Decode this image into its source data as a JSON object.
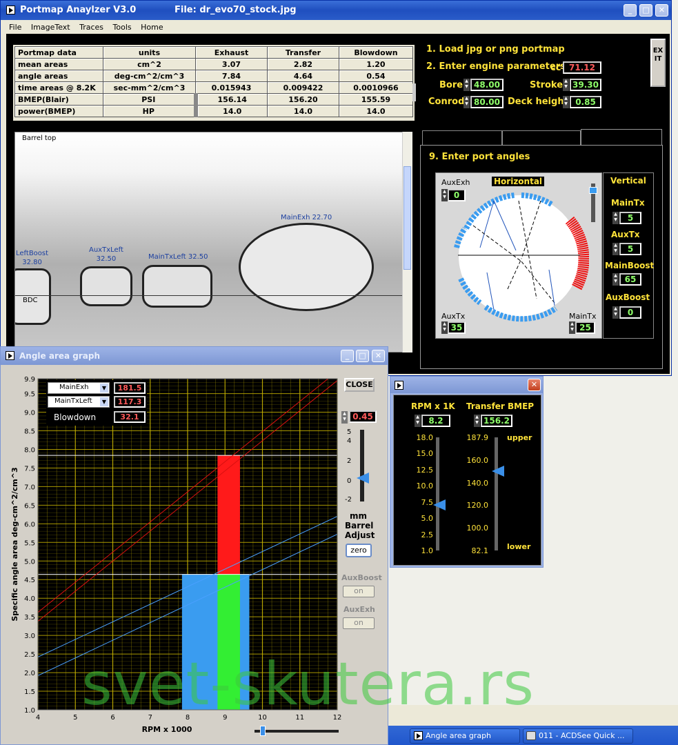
{
  "main_window": {
    "title": "Portmap Anaylzer V3.0",
    "file_label": "File:  dr_evo70_stock.jpg",
    "menu": [
      "File",
      "ImageText",
      "Traces",
      "Tools",
      "Home"
    ],
    "table": {
      "headers": [
        "Portmap data",
        "units",
        "Exhaust",
        "Transfer",
        "Blowdown"
      ],
      "rows": [
        [
          "mean areas",
          "cm^2",
          "3.07",
          "2.82",
          "1.20"
        ],
        [
          "angle areas",
          "deg-cm^2/cm^3",
          "7.84",
          "4.64",
          "0.54"
        ],
        [
          "time areas @ 8.2K",
          "sec-mm^2/cm^3",
          "0.015943",
          "0.009422",
          "0.0010966"
        ],
        [
          "BMEP(Blair)",
          "PSI",
          "156.14",
          "156.20",
          "155.59"
        ],
        [
          "power(BMEP)",
          "HP",
          "14.0",
          "14.0",
          "14.0"
        ]
      ]
    },
    "steps": {
      "load": "1. Load jpg or png portmap",
      "enter_params": "2. Enter engine parameters",
      "port_angles": "9. Enter port angles"
    },
    "exit_label": "EXIT",
    "params": {
      "cc_label": "cc",
      "cc": "71.12",
      "bore_label": "Bore",
      "bore": "48.00",
      "stroke_label": "Stroke",
      "stroke": "39.30",
      "conrod_label": "Conrod",
      "conrod": "80.00",
      "deck_label": "Deck height",
      "deck": "0.85"
    },
    "image": {
      "barrel_top": "Barrel top",
      "bdc": "BDC",
      "ports": [
        {
          "name": "LeftBoost",
          "value": "32.80"
        },
        {
          "name": "AuxTxLeft",
          "value": "32.50"
        },
        {
          "name": "MainTxLeft",
          "value": "32.50"
        },
        {
          "name": "MainExh",
          "value": "22.70"
        }
      ]
    },
    "angles": {
      "horizontal_label": "Horizontal",
      "vertical_label": "Vertical",
      "auxexh_label": "AuxExh",
      "auxexh": "0",
      "auxtx_corner_label": "AuxTx",
      "auxtx_corner": "35",
      "maintx_corner_label": "MainTx",
      "maintx_corner": "25",
      "vertical_items": [
        {
          "label": "MainTx",
          "value": "5"
        },
        {
          "label": "AuxTx",
          "value": "5"
        },
        {
          "label": "MainBoost",
          "value": "65"
        },
        {
          "label": "AuxBoost",
          "value": "0"
        }
      ]
    }
  },
  "graph_window": {
    "title": "Angle area graph",
    "close_label": "CLOSE",
    "legend": [
      {
        "name": "MainExh",
        "value": "181.5"
      },
      {
        "name": "MainTxLeft",
        "value": "117.3"
      },
      {
        "name": "Blowdown",
        "value": "32.1"
      }
    ],
    "barrel_value": "0.45",
    "slider_ticks": [
      "5",
      "4",
      "2",
      "0",
      "-2"
    ],
    "mm_label": "mm",
    "barrel_label": "Barrel",
    "adjust_label": "Adjust",
    "zero_label": "zero",
    "auxboost_label": "AuxBoost",
    "auxexh_label": "AuxExh",
    "on_label": "on",
    "colors": {
      "exhaust": "#ff1a1a",
      "transfer": "#3a9cf0",
      "blowdown": "#33ee33",
      "grid": "#c8b400"
    }
  },
  "chart_data": {
    "type": "bar",
    "xlabel": "RPM x 1000",
    "ylabel": "Specific angle area  deg-cm^2/cm^3",
    "xlim": [
      4,
      12
    ],
    "ylim": [
      1.0,
      9.9
    ],
    "x_ticks": [
      "4",
      "5",
      "6",
      "7",
      "8",
      "9",
      "10",
      "11",
      "12"
    ],
    "y_ticks": [
      "1.0",
      "1.5",
      "2.0",
      "2.5",
      "3.0",
      "3.5",
      "4.0",
      "4.5",
      "5.0",
      "5.5",
      "6.0",
      "6.5",
      "7.0",
      "7.5",
      "8.0",
      "8.5",
      "9.0",
      "9.5",
      "9.9"
    ],
    "bars": [
      {
        "name": "Transfer",
        "x0": 7.85,
        "x1": 9.65,
        "y": 4.64,
        "color": "#3a9cf0"
      },
      {
        "name": "Blowdown",
        "x0": 8.8,
        "x1": 9.4,
        "y": 4.64,
        "color": "#33ee33"
      },
      {
        "name": "Exhaust",
        "x0": 8.8,
        "x1": 9.4,
        "y0": 4.64,
        "y1": 7.84,
        "color": "#ff1a1a"
      }
    ],
    "lines": [
      {
        "name": "exhaust-upper",
        "color": "#d81010",
        "points": [
          [
            4,
            3.62
          ],
          [
            12,
            10.1
          ]
        ]
      },
      {
        "name": "exhaust-lower",
        "color": "#d81010",
        "points": [
          [
            4,
            3.38
          ],
          [
            12,
            9.85
          ]
        ]
      },
      {
        "name": "transfer-upper",
        "color": "#4aa0ff",
        "points": [
          [
            4,
            2.42
          ],
          [
            12,
            6.2
          ]
        ]
      },
      {
        "name": "transfer-lower",
        "color": "#4aa0ff",
        "points": [
          [
            4,
            1.92
          ],
          [
            12,
            5.72
          ]
        ]
      }
    ],
    "hlines": [
      7.84,
      4.64
    ],
    "grid": true
  },
  "bmep_window": {
    "rpm_label": "RPM x 1K",
    "rpm": "8.2",
    "bmep_label": "Transfer BMEP",
    "bmep": "156.2",
    "rpm_ticks": [
      "18.0",
      "15.0",
      "12.5",
      "10.0",
      "7.5",
      "5.0",
      "2.5",
      "1.0"
    ],
    "bmep_ticks": [
      "187.9",
      "160.0",
      "140.0",
      "120.0",
      "100.0",
      "82.1"
    ],
    "upper_label": "upper",
    "lower_label": "lower",
    "rpm_fraction": 0.4,
    "bmep_fraction": 0.7
  },
  "watermark": "svet-skutera.rs",
  "taskbar": [
    {
      "label": "Angle area graph"
    },
    {
      "label": "011 - ACDSee Quick ..."
    }
  ]
}
